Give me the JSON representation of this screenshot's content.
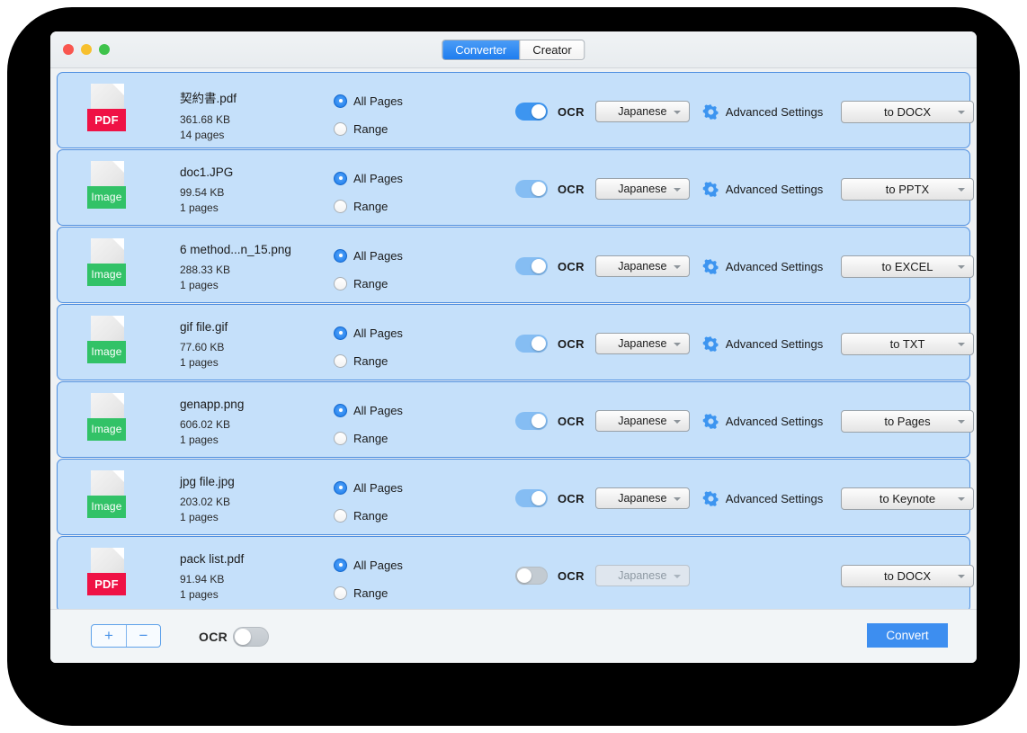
{
  "window": {
    "traffic_lights": [
      "close",
      "minimize",
      "maximize"
    ],
    "colors": {
      "accent": "#3d8ef0",
      "row_fill": "#c5e0fa",
      "row_border": "#4f8fe0",
      "pdf_badge": "#ef1245",
      "image_badge": "#32c267",
      "backdrop": "#000000"
    }
  },
  "tabs": [
    {
      "label": "Converter",
      "active": true
    },
    {
      "label": "Creator",
      "active": false
    }
  ],
  "labels": {
    "all_pages": "All Pages",
    "range": "Range",
    "ocr": "OCR",
    "advanced_settings": "Advanced Settings"
  },
  "icons": {
    "gear": "gear-icon",
    "dropdown_arrow": "chevron-down-icon",
    "add": "+",
    "remove": "−"
  },
  "rows": [
    {
      "type": "PDF",
      "badge": "PDF",
      "name": "契約書.pdf",
      "size": "361.68 KB",
      "pages": "14 pages",
      "all_pages_selected": true,
      "range_selected": false,
      "ocr_on": true,
      "ocr_state": "on",
      "language": "Japanese",
      "language_enabled": true,
      "advanced_visible": true,
      "output_format": "to DOCX"
    },
    {
      "type": "Image",
      "badge": "Image",
      "name": "doc1.JPG",
      "size": "99.54 KB",
      "pages": "1 pages",
      "all_pages_selected": true,
      "range_selected": false,
      "ocr_on": true,
      "ocr_state": "on-dim",
      "language": "Japanese",
      "language_enabled": true,
      "advanced_visible": true,
      "output_format": "to PPTX"
    },
    {
      "type": "Image",
      "badge": "Image",
      "name": "6 method...n_15.png",
      "size": "288.33 KB",
      "pages": "1 pages",
      "all_pages_selected": true,
      "range_selected": false,
      "ocr_on": true,
      "ocr_state": "on-dim",
      "language": "Japanese",
      "language_enabled": true,
      "advanced_visible": true,
      "output_format": "to EXCEL"
    },
    {
      "type": "Image",
      "badge": "Image",
      "name": "gif file.gif",
      "size": "77.60 KB",
      "pages": "1 pages",
      "all_pages_selected": true,
      "range_selected": false,
      "ocr_on": true,
      "ocr_state": "on-dim",
      "language": "Japanese",
      "language_enabled": true,
      "advanced_visible": true,
      "output_format": "to TXT"
    },
    {
      "type": "Image",
      "badge": "Image",
      "name": "genapp.png",
      "size": "606.02 KB",
      "pages": "1 pages",
      "all_pages_selected": true,
      "range_selected": false,
      "ocr_on": true,
      "ocr_state": "on-dim",
      "language": "Japanese",
      "language_enabled": true,
      "advanced_visible": true,
      "output_format": "to Pages"
    },
    {
      "type": "Image",
      "badge": "Image",
      "name": "jpg file.jpg",
      "size": "203.02 KB",
      "pages": "1 pages",
      "all_pages_selected": true,
      "range_selected": false,
      "ocr_on": true,
      "ocr_state": "on-dim",
      "language": "Japanese",
      "language_enabled": true,
      "advanced_visible": true,
      "output_format": "to Keynote"
    },
    {
      "type": "PDF",
      "badge": "PDF",
      "name": "pack list.pdf",
      "size": "91.94 KB",
      "pages": "1 pages",
      "all_pages_selected": true,
      "range_selected": false,
      "ocr_on": false,
      "ocr_state": "off",
      "language": "Japanese",
      "language_enabled": false,
      "advanced_visible": false,
      "output_format": "to DOCX"
    }
  ],
  "bottom_bar": {
    "add_label": "+",
    "remove_label": "−",
    "ocr_label": "OCR",
    "ocr_on": false,
    "convert_label": "Convert"
  }
}
